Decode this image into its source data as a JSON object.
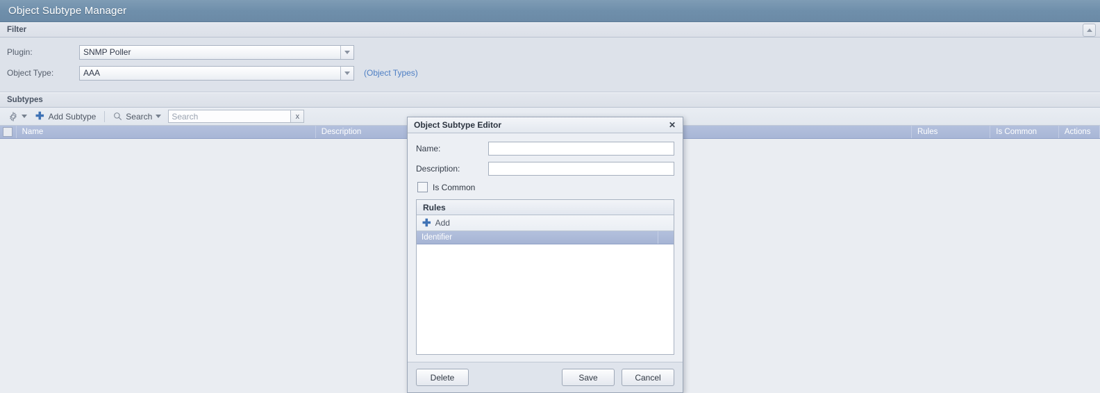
{
  "app": {
    "title": "Object Subtype Manager"
  },
  "filter_section": {
    "title": "Filter",
    "collapse_icon": "chevron-up-icon",
    "plugin": {
      "label": "Plugin:",
      "value": "SNMP Poller"
    },
    "object_type": {
      "label": "Object Type:",
      "value": "AAA"
    },
    "object_types_link": "(Object Types)"
  },
  "subtypes_section": {
    "title": "Subtypes",
    "toolbar": {
      "gear_icon": "gear-icon",
      "gear_caret_icon": "chevron-down-icon",
      "add_subtype_label": "Add Subtype",
      "add_icon": "plus-icon",
      "search_label": "Search",
      "search_icon": "magnifier-icon",
      "search_caret_icon": "chevron-down-icon",
      "search_value": "",
      "search_placeholder": "Search",
      "clear_label": "x"
    },
    "grid": {
      "columns": [
        "Name",
        "Description",
        "Rules",
        "Is Common",
        "Actions"
      ],
      "rows": []
    }
  },
  "dialog": {
    "title": "Object Subtype Editor",
    "close_label": "✕",
    "name": {
      "label": "Name:",
      "value": "",
      "placeholder": ""
    },
    "description": {
      "label": "Description:",
      "value": "",
      "placeholder": ""
    },
    "is_common": {
      "label": "Is Common",
      "checked": false
    },
    "rules": {
      "title": "Rules",
      "add_label": "Add",
      "add_icon": "plus-icon",
      "columns": [
        "Identifier",
        ""
      ],
      "rows": []
    },
    "buttons": {
      "delete": "Delete",
      "save": "Save",
      "cancel": "Cancel"
    }
  },
  "colors": {
    "app_header": "#6f8fab",
    "grid_header": "#a8b6d6",
    "link": "#4e7fc4",
    "accent_plus": "#3f72b5",
    "panel_bg": "#dde2ea",
    "body_bg": "#eaedf2"
  }
}
